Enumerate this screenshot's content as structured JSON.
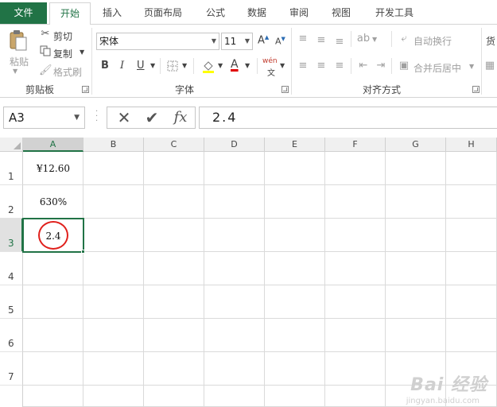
{
  "tabs": {
    "file": "文件",
    "items": [
      "开始",
      "插入",
      "页面布局",
      "公式",
      "数据",
      "审阅",
      "视图",
      "开发工具"
    ],
    "active": "开始"
  },
  "ribbon": {
    "clipboard": {
      "label": "剪贴板",
      "paste": "粘贴",
      "cut": "剪切",
      "copy": "复制",
      "format_painter": "格式刷"
    },
    "font": {
      "label": "字体",
      "font_name": "宋体",
      "font_size": "11",
      "bold": "B",
      "italic": "I",
      "underline": "U",
      "font_color_letter": "A",
      "phonetic": "wén"
    },
    "alignment": {
      "label": "对齐方式",
      "wrap_text": "自动换行",
      "merge_center": "合并后居中"
    },
    "number": {
      "partial_label": "货"
    }
  },
  "formula_bar": {
    "name_box": "A3",
    "fx": "fx",
    "value": "2.4"
  },
  "grid": {
    "columns": [
      "A",
      "B",
      "C",
      "D",
      "E",
      "F",
      "G",
      "H"
    ],
    "selected_column": "A",
    "rows": [
      "1",
      "2",
      "3",
      "4",
      "5",
      "6",
      "7"
    ],
    "selected_row": "3",
    "cells": {
      "A1": "¥12.60",
      "A2": "630%",
      "A3": "2.4"
    }
  },
  "colors": {
    "accent": "#217346",
    "highlight_circle": "#e0201c"
  },
  "watermark": {
    "text": "Bai 经验",
    "sub": "jingyan.baidu.com"
  }
}
